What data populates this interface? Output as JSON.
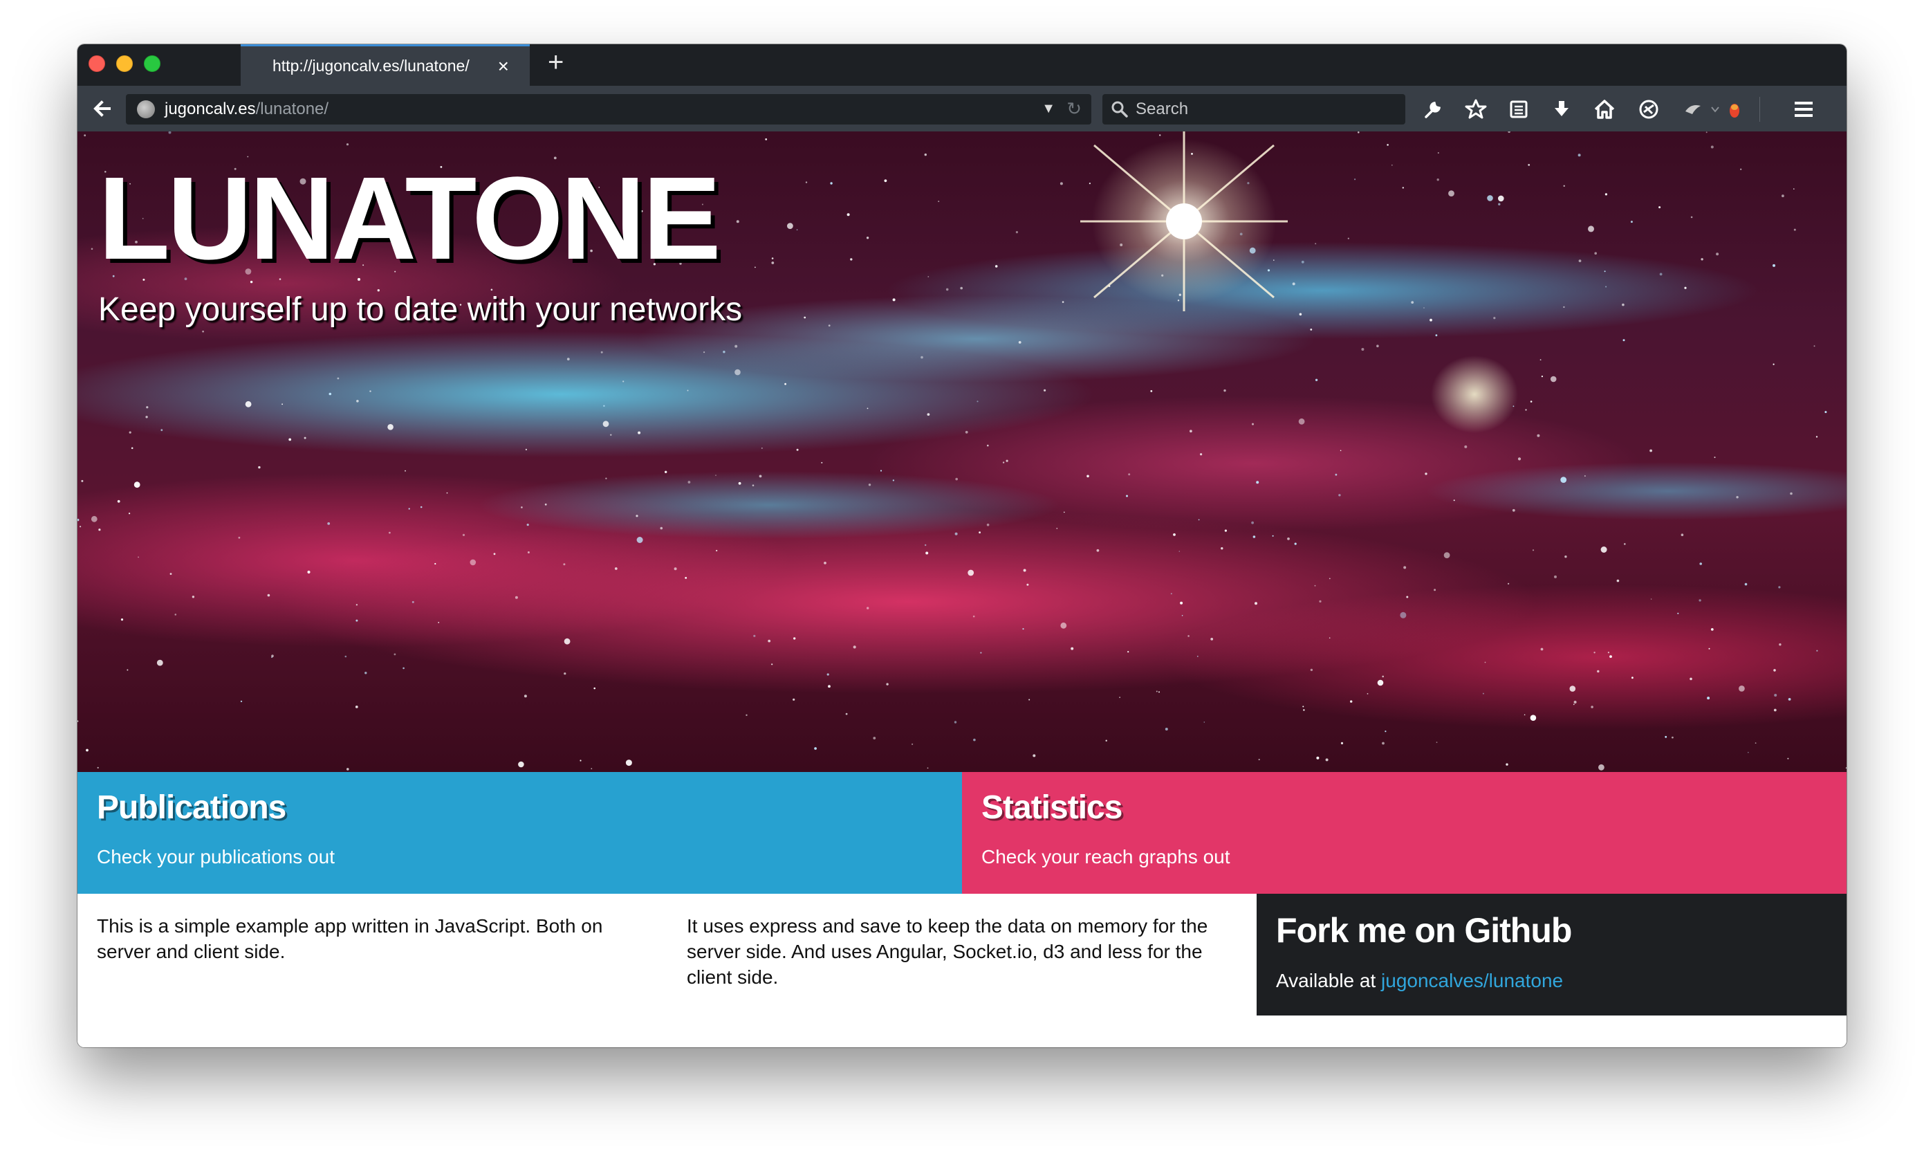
{
  "browser": {
    "tab_title": "http://jugoncalv.es/lunatone/",
    "tab_close": "×",
    "new_tab": "+",
    "url_host": "jugoncalv.es",
    "url_path": "/lunatone/",
    "search_placeholder": "Search",
    "accent_color": "#3b8ed8",
    "toolbar_icons": [
      "wrench-icon",
      "star-icon",
      "reading-list-icon",
      "download-icon",
      "home-icon",
      "sync-icon",
      "extension-icon",
      "firebug-icon",
      "menu-icon"
    ]
  },
  "hero": {
    "title": "LUNATONE",
    "subtitle": "Keep yourself up to date with your networks"
  },
  "cards": {
    "publications": {
      "title": "Publications",
      "text": "Check your publications out",
      "color": "#27a1d0"
    },
    "statistics": {
      "title": "Statistics",
      "text": "Check your reach graphs out",
      "color": "#e23668"
    }
  },
  "info": {
    "col1": "This is a simple example app written in JavaScript. Both on server and client side.",
    "col2": "It uses express and save to keep the data on memory for the server side. And uses Angular, Socket.io, d3 and less for the client side."
  },
  "fork": {
    "title": "Fork me on Github",
    "prefix": "Available at ",
    "link": "jugoncalves/lunatone"
  }
}
